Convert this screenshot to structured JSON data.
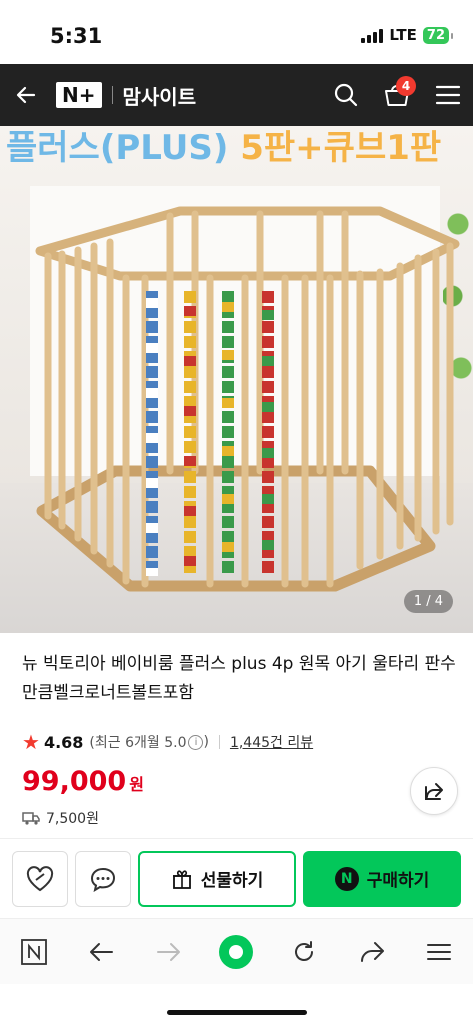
{
  "status_bar": {
    "time": "5:31",
    "network": "LTE",
    "battery": "72"
  },
  "header": {
    "brand": "N+",
    "site_name": "맘사이트",
    "cart_count": "4"
  },
  "image": {
    "banner_text_blue": "플러스(PLUS)",
    "banner_text_orange": "5판+큐브1판",
    "page_indicator": "1 / 4"
  },
  "product": {
    "title": "뉴 빅토리아 베이비룸 플러스 plus 4p 원목 아기 울타리 판수만큼벨크로너트볼트포함",
    "rating": "4.68",
    "recent_rating": "(최근 6개월 5.0",
    "reviews": "1,445건 리뷰",
    "price": "99,000",
    "currency": "원",
    "shipping": "7,500원"
  },
  "actions": {
    "gift_label": "선물하기",
    "buy_label": "구매하기",
    "buy_badge": "N"
  },
  "colors": {
    "accent_green": "#03c75a",
    "price_red": "#e0001c",
    "star_red": "#f23a2f"
  }
}
